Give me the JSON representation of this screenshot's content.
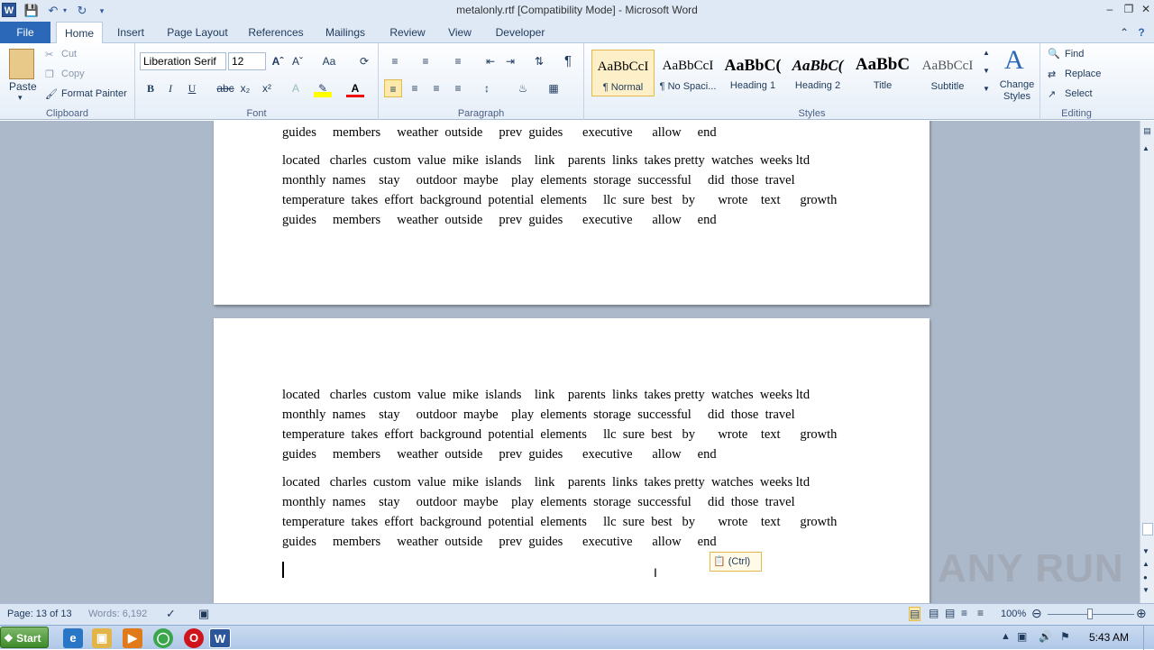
{
  "window": {
    "title": "metalonly.rtf [Compatibility Mode]  -  Microsoft Word",
    "app_icon": "W"
  },
  "tabs": [
    "File",
    "Home",
    "Insert",
    "Page Layout",
    "References",
    "Mailings",
    "Review",
    "View",
    "Developer"
  ],
  "clipboard": {
    "paste": "Paste",
    "cut": "Cut",
    "copy": "Copy",
    "format_painter": "Format Painter",
    "label": "Clipboard"
  },
  "font": {
    "family": "Liberation Serif",
    "size": "12",
    "label": "Font",
    "aa": "Aa"
  },
  "paragraph": {
    "label": "Paragraph"
  },
  "styles": {
    "label": "Styles",
    "items": [
      {
        "preview": "AaBbCcI",
        "name": "¶ Normal"
      },
      {
        "preview": "AaBbCcI",
        "name": "¶ No Spaci..."
      },
      {
        "preview": "AaBbC(",
        "name": "Heading 1"
      },
      {
        "preview": "AaBbC(",
        "name": "Heading 2"
      },
      {
        "preview": "AaBbC",
        "name": "Title"
      },
      {
        "preview": "AaBbCcI",
        "name": "Subtitle"
      }
    ],
    "change_styles": "Change Styles"
  },
  "editing": {
    "find": "Find",
    "replace": "Replace",
    "select": "Select",
    "label": "Editing"
  },
  "document": {
    "line1": "located   charles  custom  value  mike  islands    link    parents  links  takes pretty  watches  weeks ltd",
    "line2": "monthly  names    stay     outdoor  maybe    play  elements  storage  successful     did  those  travel",
    "line3": "temperature  takes  effort  background  potential  elements     llc  sure  best   by       wrote    text      growth",
    "line4": "guides     members     weather  outside     prev  guides      executive      allow     end",
    "paste_options": "(Ctrl)"
  },
  "status": {
    "page": "Page: 13 of 13",
    "words": "Words: 6,192",
    "zoom": "100%"
  },
  "taskbar": {
    "start": "Start",
    "time": "5:43 AM"
  },
  "watermark": "ANY RUN"
}
